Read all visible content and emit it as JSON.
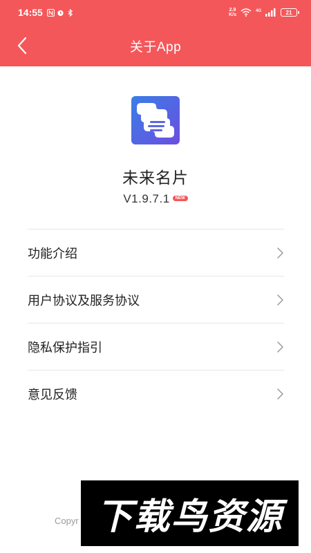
{
  "status_bar": {
    "time": "14:55",
    "net_speed_value": "2.9",
    "net_speed_unit": "K/s",
    "network_label": "4G",
    "battery": "21",
    "icons": [
      "nfc-icon",
      "alarm-icon",
      "bluetooth-icon",
      "wifi-icon",
      "signal-icon",
      "battery-icon"
    ]
  },
  "app_bar": {
    "title": "关于App",
    "back_icon": "chevron-left-icon"
  },
  "app_info": {
    "name": "未来名片",
    "version": "V1.9.7.1",
    "badge": "NEW"
  },
  "menu": {
    "items": [
      {
        "label": "功能介绍",
        "icon": "chevron-right-icon"
      },
      {
        "label": "用户协议及服务协议",
        "icon": "chevron-right-icon"
      },
      {
        "label": "隐私保护指引",
        "icon": "chevron-right-icon"
      },
      {
        "label": "意见反馈",
        "icon": "chevron-right-icon"
      }
    ]
  },
  "footer": {
    "copyright_fragment": "Copyr"
  },
  "watermark": {
    "text": "下载鸟资源"
  },
  "colors": {
    "accent": "#f4575a",
    "logo_bg_start": "#3a7ee6",
    "logo_bg_end": "#6a4fe0",
    "divider": "#e6e6e6"
  }
}
